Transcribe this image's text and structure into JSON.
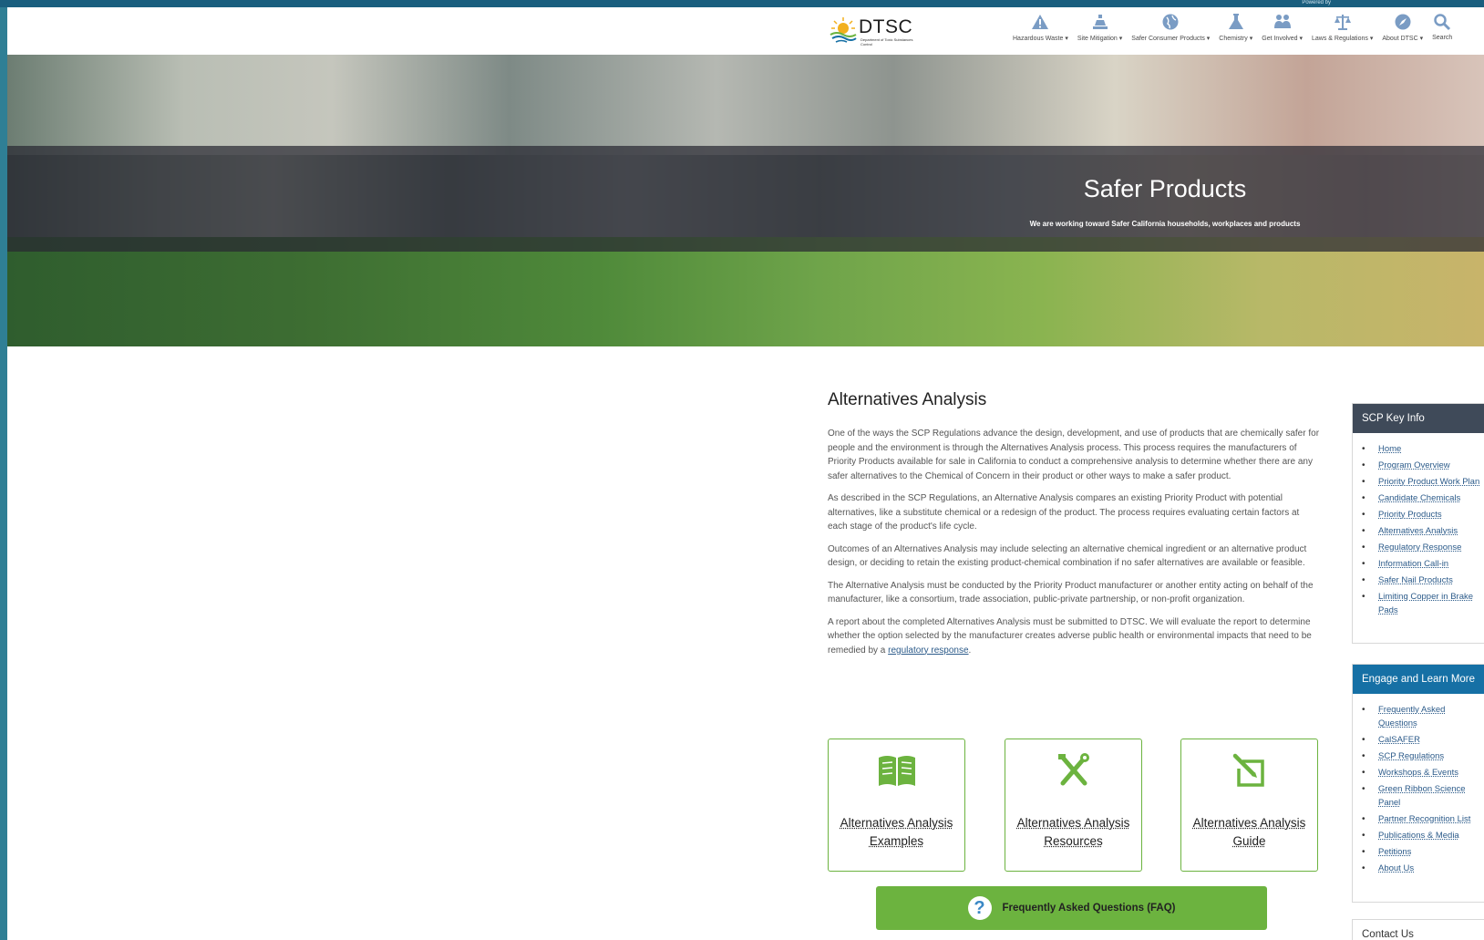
{
  "header": {
    "powered_by": "Powered by",
    "logo": {
      "wordmark": "DTSC",
      "subtitle": "Department of Toxic Substances Control"
    },
    "nav": [
      {
        "label": "Hazardous Waste ▾",
        "icon": "warning-icon"
      },
      {
        "label": "Site Mitigation ▾",
        "icon": "site-icon"
      },
      {
        "label": "Safer Consumer Products ▾",
        "icon": "globe-icon"
      },
      {
        "label": "Chemistry ▾",
        "icon": "flask-icon"
      },
      {
        "label": "Get Involved ▾",
        "icon": "people-icon"
      },
      {
        "label": "Laws & Regulations ▾",
        "icon": "scales-icon"
      },
      {
        "label": "About DTSC ▾",
        "icon": "compass-icon"
      },
      {
        "label": "Search",
        "icon": "search-icon"
      }
    ]
  },
  "hero": {
    "title": "Safer Products",
    "subtitle": "We are working toward Safer California households, workplaces and products"
  },
  "main": {
    "heading": "Alternatives Analysis",
    "paragraphs": [
      "One of the ways the SCP Regulations advance the design, development, and use of products that are chemically safer for people and the environment is through the Alternatives Analysis process. This process requires the manufacturers of Priority Products available for sale in California to conduct a comprehensive analysis to determine whether there are any safer alternatives to the Chemical of Concern in their product or other ways to make a safer product.",
      "As described in the SCP Regulations, an Alternative Analysis compares an existing Priority Product with potential alternatives, like a substitute chemical or a redesign of the product. The process requires evaluating certain factors at each stage of the product's life cycle.",
      "Outcomes of an Alternatives Analysis may include selecting an alternative chemical ingredient or an alternative product design, or deciding to retain the existing product-chemical combination if no safer alternatives are available or feasible.",
      "The Alternative Analysis must be conducted by the Priority Product manufacturer or another entity acting on behalf of the manufacturer, like a consortium, trade association, public-private partnership, or non-profit organization."
    ],
    "last_paragraph_prefix": "A report about the completed Alternatives Analysis must be submitted to DTSC. We will evaluate the report to determine whether the option selected by the manufacturer creates adverse public health or environmental impacts that need to be remedied by a ",
    "last_paragraph_link": "regulatory response",
    "last_paragraph_suffix": "."
  },
  "cards": [
    {
      "line1": "Alternatives Analysis",
      "line2": "Examples",
      "icon": "open-book-icon"
    },
    {
      "line1": "Alternatives Analysis",
      "line2": "Resources",
      "icon": "tools-icon"
    },
    {
      "line1": "Alternatives Analysis",
      "line2": "Guide",
      "icon": "edit-box-icon"
    }
  ],
  "faq_button": {
    "label": "Frequently Asked Questions (FAQ)",
    "icon": "question-icon"
  },
  "sidebar": {
    "key_info": {
      "title": "SCP Key Info",
      "items": [
        "Home",
        "Program Overview",
        "Priority Product Work Plan",
        "Candidate Chemicals",
        "Priority Products",
        "Alternatives Analysis",
        "Regulatory Response",
        "Information Call-in",
        "Safer Nail Products",
        "Limiting Copper in Brake Pads"
      ]
    },
    "engage": {
      "title": "Engage and Learn More",
      "items": [
        "Frequently Asked Questions",
        "CalSAFER",
        "SCP Regulations",
        "Workshops & Events",
        "Green Ribbon Science Panel",
        "Partner Recognition List",
        "Publications & Media",
        "Petitions",
        "About Us"
      ]
    },
    "contact": {
      "title": "Contact Us"
    }
  },
  "colors": {
    "accent_green": "#6cb33f",
    "blue_box": "#1670a5",
    "dark_box": "#3f4a59",
    "frame": "#2f7f95"
  }
}
